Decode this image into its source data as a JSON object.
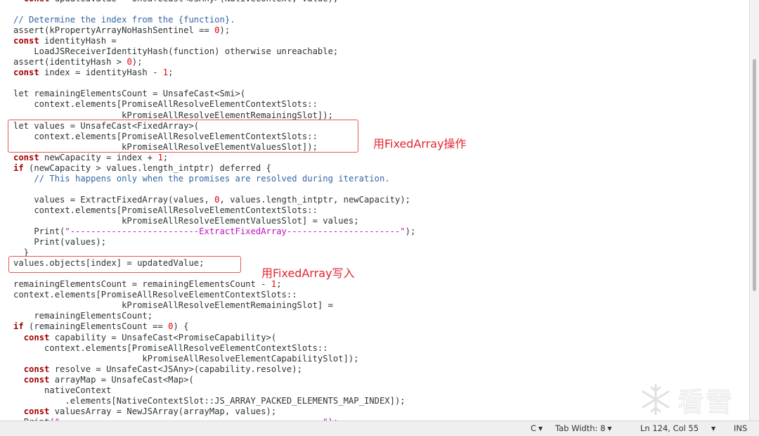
{
  "editor": {
    "lines": [
      [
        {
          "t": "  "
        },
        {
          "t": "const",
          "c": "kw"
        },
        {
          "t": " updatedValue = UnsafeCast<JSAny>(NativeContext, value);"
        }
      ],
      [
        {
          "t": ""
        }
      ],
      [
        {
          "t": "// Determine the index from the {function}.",
          "c": "cm"
        }
      ],
      [
        {
          "t": "assert(kPropertyArrayNoHashSentinel == "
        },
        {
          "t": "0",
          "c": "num"
        },
        {
          "t": ");"
        }
      ],
      [
        {
          "t": "const",
          "c": "kw"
        },
        {
          "t": " identityHash ="
        }
      ],
      [
        {
          "t": "    LoadJSReceiverIdentityHash(function) otherwise unreachable;"
        }
      ],
      [
        {
          "t": "assert(identityHash > "
        },
        {
          "t": "0",
          "c": "num"
        },
        {
          "t": ");"
        }
      ],
      [
        {
          "t": "const",
          "c": "kw"
        },
        {
          "t": " index = identityHash - "
        },
        {
          "t": "1",
          "c": "num"
        },
        {
          "t": ";"
        }
      ],
      [
        {
          "t": ""
        }
      ],
      [
        {
          "t": "let remainingElementsCount = UnsafeCast<Smi>("
        }
      ],
      [
        {
          "t": "    context.elements[PromiseAllResolveElementContextSlots::"
        }
      ],
      [
        {
          "t": "                     kPromiseAllResolveElementRemainingSlot]);"
        }
      ],
      [
        {
          "t": "let values = UnsafeCast<FixedArray>("
        }
      ],
      [
        {
          "t": "    context.elements[PromiseAllResolveElementContextSlots::"
        }
      ],
      [
        {
          "t": "                     kPromiseAllResolveElementValuesSlot]);"
        }
      ],
      [
        {
          "t": "const",
          "c": "kw"
        },
        {
          "t": " newCapacity = index + "
        },
        {
          "t": "1",
          "c": "num"
        },
        {
          "t": ";"
        }
      ],
      [
        {
          "t": "if",
          "c": "kw"
        },
        {
          "t": " (newCapacity > values.length_intptr) deferred {"
        }
      ],
      [
        {
          "t": "    "
        },
        {
          "t": "// This happens only when the promises are resolved during iteration.",
          "c": "cm"
        }
      ],
      [
        {
          "t": ""
        }
      ],
      [
        {
          "t": "    values = ExtractFixedArray(values, "
        },
        {
          "t": "0",
          "c": "num"
        },
        {
          "t": ", values.length_intptr, newCapacity);"
        }
      ],
      [
        {
          "t": "    context.elements[PromiseAllResolveElementContextSlots::"
        }
      ],
      [
        {
          "t": "                     kPromiseAllResolveElementValuesSlot] = values;"
        }
      ],
      [
        {
          "t": "    Print("
        },
        {
          "t": "\"-------------------------ExtractFixedArray----------------------\"",
          "c": "str"
        },
        {
          "t": ");"
        }
      ],
      [
        {
          "t": "    Print(values);"
        }
      ],
      [
        {
          "t": "  }"
        }
      ],
      [
        {
          "t": "values.objects[index] = updatedValue;"
        }
      ],
      [
        {
          "t": ""
        }
      ],
      [
        {
          "t": "remainingElementsCount = remainingElementsCount - "
        },
        {
          "t": "1",
          "c": "num"
        },
        {
          "t": ";"
        }
      ],
      [
        {
          "t": "context.elements[PromiseAllResolveElementContextSlots::"
        }
      ],
      [
        {
          "t": "                     kPromiseAllResolveElementRemainingSlot] ="
        }
      ],
      [
        {
          "t": "    remainingElementsCount;"
        }
      ],
      [
        {
          "t": "if",
          "c": "kw"
        },
        {
          "t": " (remainingElementsCount == "
        },
        {
          "t": "0",
          "c": "num"
        },
        {
          "t": ") {"
        }
      ],
      [
        {
          "t": "  "
        },
        {
          "t": "const",
          "c": "kw"
        },
        {
          "t": " capability = UnsafeCast<PromiseCapability>("
        }
      ],
      [
        {
          "t": "      context.elements[PromiseAllResolveElementContextSlots::"
        }
      ],
      [
        {
          "t": "                         kPromiseAllResolveElementCapabilitySlot]);"
        }
      ],
      [
        {
          "t": "  "
        },
        {
          "t": "const",
          "c": "kw"
        },
        {
          "t": " resolve = UnsafeCast<JSAny>(capability.resolve);"
        }
      ],
      [
        {
          "t": "  "
        },
        {
          "t": "const",
          "c": "kw"
        },
        {
          "t": " arrayMap = UnsafeCast<Map>("
        }
      ],
      [
        {
          "t": "      nativeContext"
        }
      ],
      [
        {
          "t": "          .elements[NativeContextSlot::JS_ARRAY_PACKED_ELEMENTS_MAP_INDEX]);"
        }
      ],
      [
        {
          "t": "  "
        },
        {
          "t": "const",
          "c": "kw"
        },
        {
          "t": " valuesArray = NewJSArray(arrayMap, values);"
        }
      ],
      [
        {
          "t": "  Print("
        },
        {
          "t": "\"---------------------------------------------------\"",
          "c": "str"
        },
        {
          "t": ");"
        }
      ]
    ]
  },
  "annotations": {
    "box1_label": "用FixedArray操作",
    "box2_label": "用FixedArray写入"
  },
  "watermark": {
    "text": "看雪",
    "icon": "snowflake-icon"
  },
  "statusbar": {
    "language": "C",
    "tab_width": "Tab Width: 8",
    "position": "Ln 124, Col 55",
    "mode": "INS"
  },
  "colors": {
    "keyword": "#a40000",
    "comment": "#3465a4",
    "number": "#e90000",
    "string": "#c010c0",
    "annotation": "#e5232f"
  }
}
